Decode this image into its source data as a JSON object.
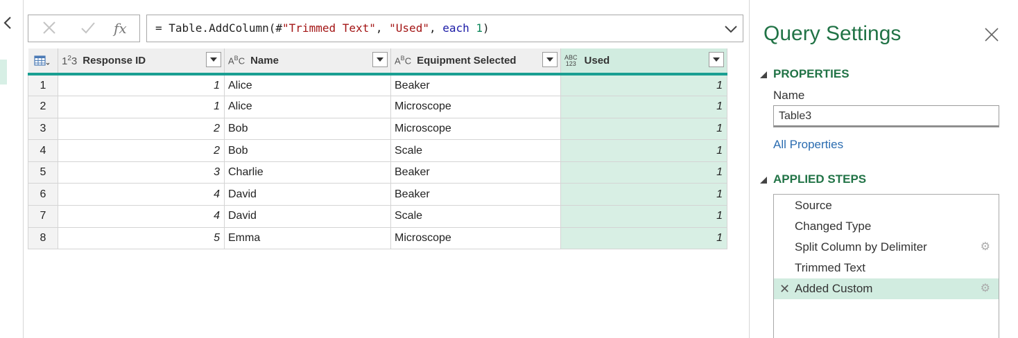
{
  "formula": {
    "prefix": "= Table.AddColumn(#",
    "arg1": "\"Trimmed Text\"",
    "sep1": ", ",
    "arg2": "\"Used\"",
    "sep2": ", ",
    "kw": "each",
    "space": " ",
    "num": "1",
    "suffix": ")",
    "fx_label": "fx"
  },
  "grid": {
    "columns": [
      {
        "type_icon": "1²3",
        "label": "Response ID"
      },
      {
        "type_icon": "ABC",
        "label": "Name"
      },
      {
        "type_icon": "ABC",
        "label": "Equipment Selected"
      },
      {
        "type_icon": "ABC/123",
        "label": "Used"
      }
    ],
    "rows": [
      {
        "n": "1",
        "id": "1",
        "name": "Alice",
        "equip": "Beaker",
        "used": "1"
      },
      {
        "n": "2",
        "id": "1",
        "name": "Alice",
        "equip": "Microscope",
        "used": "1"
      },
      {
        "n": "3",
        "id": "2",
        "name": "Bob",
        "equip": "Microscope",
        "used": "1"
      },
      {
        "n": "4",
        "id": "2",
        "name": "Bob",
        "equip": "Scale",
        "used": "1"
      },
      {
        "n": "5",
        "id": "3",
        "name": "Charlie",
        "equip": "Beaker",
        "used": "1"
      },
      {
        "n": "6",
        "id": "4",
        "name": "David",
        "equip": "Beaker",
        "used": "1"
      },
      {
        "n": "7",
        "id": "4",
        "name": "David",
        "equip": "Scale",
        "used": "1"
      },
      {
        "n": "8",
        "id": "5",
        "name": "Emma",
        "equip": "Microscope",
        "used": "1"
      }
    ]
  },
  "query_settings": {
    "title": "Query Settings",
    "properties_head": "PROPERTIES",
    "name_label": "Name",
    "name_value": "Table3",
    "all_properties": "All Properties",
    "steps_head": "APPLIED STEPS",
    "steps": [
      {
        "label": "Source"
      },
      {
        "label": "Changed Type"
      },
      {
        "label": "Split Column by Delimiter"
      },
      {
        "label": "Trimmed Text"
      },
      {
        "label": "Added Custom"
      }
    ]
  },
  "colors": {
    "accent_green": "#217346",
    "column_selected": "#d1ece0",
    "header_underline": "#1a9f92",
    "link": "#2b6cb0"
  },
  "icons": [
    "chevron-left-icon",
    "cancel-icon",
    "check-icon",
    "fx-icon",
    "chevron-down-icon",
    "table-menu-icon",
    "filter-dropdown-icon",
    "close-icon",
    "gear-icon",
    "delete-step-icon"
  ]
}
